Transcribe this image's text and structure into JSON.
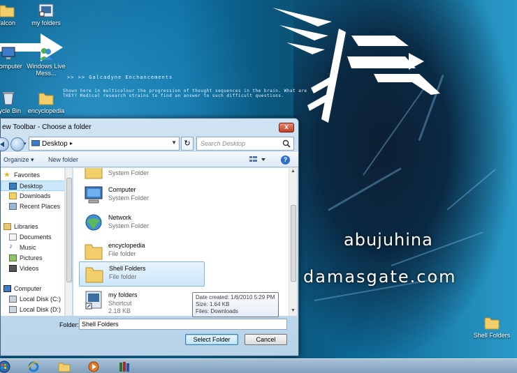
{
  "desktop": {
    "icons": [
      {
        "label": "falcon",
        "icon": "folder-icon"
      },
      {
        "label": "my folders",
        "icon": "shortcut-icon"
      },
      {
        "label": "Computer",
        "icon": "computer-icon"
      },
      {
        "label": "Windows Live Mess...",
        "icon": "messenger-icon"
      },
      {
        "label": "cycle Bin",
        "icon": "recycle-bin-icon"
      },
      {
        "label": "encyclopedia",
        "icon": "folder-icon"
      },
      {
        "label": "Shell Folders",
        "icon": "folder-icon"
      }
    ],
    "tagline": ">> >> Galcadyne Enchancements",
    "blurb_line1": "Shown here in multicolour the progression of thought sequences in the brain. What are",
    "blurb_line2": "THEY? Medical research strains to find an answer to such difficult questions.",
    "watermark1": "abujuhina",
    "watermark2": "damasgate.com"
  },
  "dialog": {
    "title": "ew Toolbar - Choose a folder",
    "close_label": "x",
    "address": "Desktop",
    "search_placeholder": "Search Desktop",
    "organize_label": "Organize",
    "new_folder_label": "New folder",
    "help_label": "?",
    "nav_items": [
      {
        "label": "Favorites",
        "icon": "star-icon"
      },
      {
        "label": "Desktop",
        "icon": "desktop-icon"
      },
      {
        "label": "Downloads",
        "icon": "downloads-icon"
      },
      {
        "label": "Recent Places",
        "icon": "recent-places-icon"
      },
      {
        "label": "Libraries",
        "icon": "libraries-icon"
      },
      {
        "label": "Documents",
        "icon": "documents-icon"
      },
      {
        "label": "Music",
        "icon": "music-icon"
      },
      {
        "label": "Pictures",
        "icon": "pictures-icon"
      },
      {
        "label": "Videos",
        "icon": "videos-icon"
      },
      {
        "label": "Computer",
        "icon": "computer-icon"
      },
      {
        "label": "Local Disk (C:)",
        "icon": "disk-icon"
      },
      {
        "label": "Local Disk (D:)",
        "icon": "disk-icon"
      }
    ],
    "files": [
      {
        "name": "",
        "type": "System Folder",
        "icon": "folder-icon"
      },
      {
        "name": "Computer",
        "type": "System Folder",
        "icon": "computer-icon"
      },
      {
        "name": "Network",
        "type": "System Folder",
        "icon": "network-icon"
      },
      {
        "name": "encyclopedia",
        "type": "File folder",
        "icon": "folder-icon"
      },
      {
        "name": "Shell Folders",
        "type": "File folder",
        "icon": "folder-icon"
      },
      {
        "name": "my folders",
        "type": "Shortcut",
        "size": "2.18 KB",
        "icon": "shortcut-icon"
      }
    ],
    "tooltip": {
      "created": "Date created: 1/6/2010 5:29 PM",
      "size": "Size: 1.64 KB",
      "files": "Files: Downloads"
    },
    "folder_label": "Folder:",
    "folder_value": "Shell Folders",
    "select_label": "Select Folder",
    "cancel_label": "Cancel"
  },
  "taskbar": {
    "icons": [
      "start-orb-icon",
      "internet-explorer-icon",
      "explorer-icon",
      "media-player-icon",
      "books-icon"
    ]
  },
  "colors": {
    "selection": "#cce8ff",
    "dialog_frame": "#b9d3ea",
    "wall_blue": "#0c6ea0"
  }
}
